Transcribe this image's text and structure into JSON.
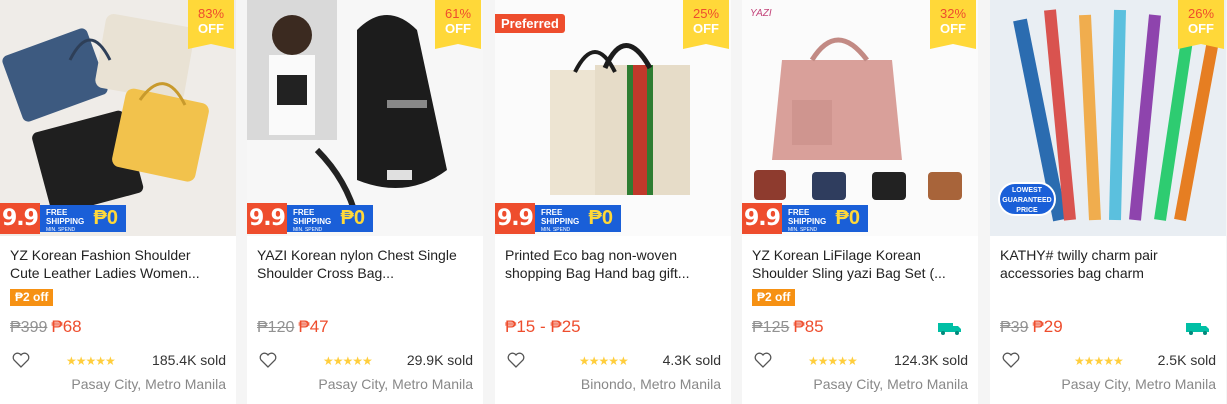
{
  "products": [
    {
      "discount_pct": "83%",
      "discount_off": "OFF",
      "promo_num": "9.9",
      "promo_ship": "FREE",
      "promo_ship2": "SHIPPING",
      "promo_min": "MIN. SPEND",
      "promo_zero": "₱0",
      "title": "YZ Korean Fashion Shoulder Cute Leather Ladies Women...",
      "voucher": "₱2 off",
      "old_price": "₱399",
      "price": "₱68",
      "sold": "185.4K sold",
      "location": "Pasay City, Metro Manila",
      "stars": "★★★★★"
    },
    {
      "discount_pct": "61%",
      "discount_off": "OFF",
      "promo_num": "9.9",
      "promo_ship": "FREE",
      "promo_ship2": "SHIPPING",
      "promo_min": "MIN. SPEND",
      "promo_zero": "₱0",
      "title": "YAZI Korean nylon Chest Single Shoulder Cross Bag...",
      "old_price": "₱120",
      "price": "₱47",
      "sold": "29.9K sold",
      "location": "Pasay City, Metro Manila",
      "stars": "★★★★★"
    },
    {
      "preferred": "Preferred",
      "discount_pct": "25%",
      "discount_off": "OFF",
      "promo_num": "9.9",
      "promo_ship": "FREE",
      "promo_ship2": "SHIPPING",
      "promo_min": "MIN. SPEND",
      "promo_zero": "₱0",
      "title": "Printed Eco bag non-woven shopping Bag Hand bag gift...",
      "price": "₱15 - ₱25",
      "sold": "4.3K sold",
      "location": "Binondo, Metro Manila",
      "stars": "★★★★★"
    },
    {
      "brand": "YAZI",
      "discount_pct": "32%",
      "discount_off": "OFF",
      "promo_num": "9.9",
      "promo_ship": "FREE",
      "promo_ship2": "SHIPPING",
      "promo_min": "MIN. SPEND",
      "promo_zero": "₱0",
      "title": "YZ Korean LiFilage Korean Shoulder Sling yazi Bag Set (...",
      "voucher": "₱2 off",
      "old_price": "₱125",
      "price": "₱85",
      "sold": "124.3K sold",
      "location": "Pasay City, Metro Manila",
      "stars": "★★★★★",
      "free_shipping_icon": "truck-icon"
    },
    {
      "discount_pct": "26%",
      "discount_off": "OFF",
      "badge_lowest": "LOWEST",
      "badge_guaranteed": "GUARANTEED",
      "badge_price": "PRICE",
      "title": "KATHY# twilly charm pair accessories bag charm",
      "old_price": "₱39",
      "price": "₱29",
      "sold": "2.5K sold",
      "location": "Pasay City, Metro Manila",
      "stars": "★★★★★",
      "free_shipping_icon": "truck-icon"
    }
  ],
  "colors": {
    "accent": "#ee4d2d",
    "discount_badge": "#ffd839",
    "free_ship_blue": "#1a5fd8",
    "star": "#ffce3d",
    "truck": "#00bfa5"
  },
  "icons": {
    "like": "heart-outline-icon",
    "shipping": "truck-icon"
  }
}
